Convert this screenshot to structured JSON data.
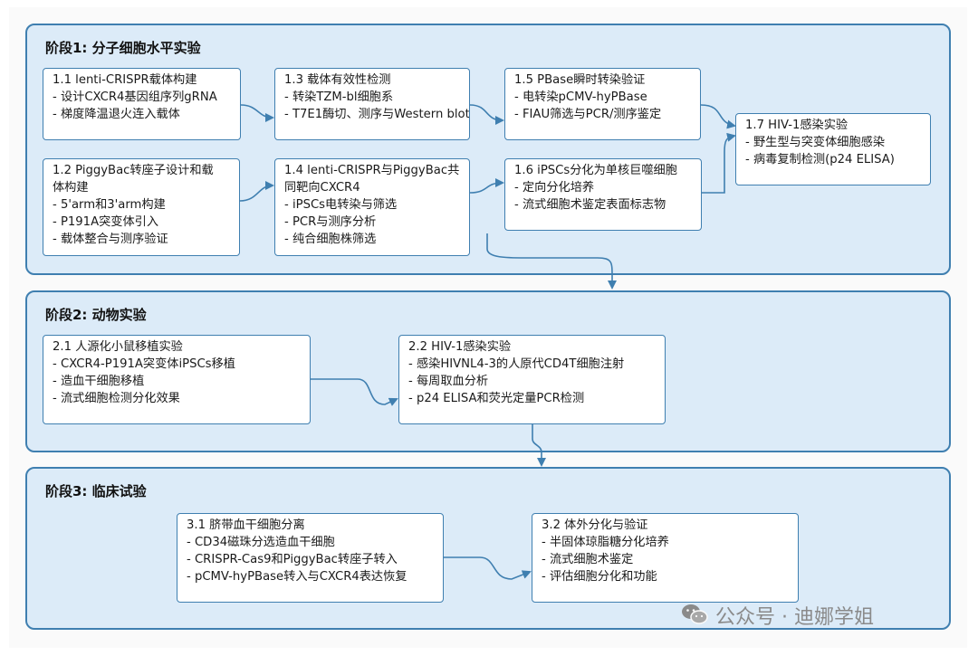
{
  "stages": [
    {
      "title": "阶段1: 分子细胞水平实验",
      "boxes": [
        {
          "title": "1.1 lenti-CRISPR载体构建",
          "items": [
            "- 设计CXCR4基因组序列gRNA",
            "- 梯度降温退火连入载体"
          ]
        },
        {
          "title": "1.2 PiggyBac转座子设计和载体构建",
          "items": [
            "- 5'arm和3'arm构建",
            "- P191A突变体引入",
            "- 载体整合与测序验证"
          ]
        },
        {
          "title": "1.3 载体有效性检测",
          "items": [
            "- 转染TZM-bl细胞系",
            "- T7E1酶切、测序与Western blot"
          ]
        },
        {
          "title": "1.4 lenti-CRISPR与PiggyBac共同靶向CXCR4",
          "items": [
            "- iPSCs电转染与筛选",
            "- PCR与测序分析",
            "- 纯合细胞株筛选"
          ]
        },
        {
          "title": "1.5 PBase瞬时转染验证",
          "items": [
            "- 电转染pCMV-hyPBase",
            "- FIAU筛选与PCR/测序鉴定"
          ]
        },
        {
          "title": "1.6 iPSCs分化为单核巨噬细胞",
          "items": [
            "- 定向分化培养",
            "- 流式细胞术鉴定表面标志物"
          ]
        },
        {
          "title": "1.7 HIV-1感染实验",
          "items": [
            "- 野生型与突变体细胞感染",
            "- 病毒复制检测(p24 ELISA)"
          ]
        }
      ]
    },
    {
      "title": "阶段2: 动物实验",
      "boxes": [
        {
          "title": "2.1 人源化小鼠移植实验",
          "items": [
            "- CXCR4-P191A突变体iPSCs移植",
            "- 造血干细胞移植",
            "- 流式细胞检测分化效果"
          ]
        },
        {
          "title": "2.2 HIV-1感染实验",
          "items": [
            "- 感染HIVNL4-3的人原代CD4T细胞注射",
            "- 每周取血分析",
            "- p24 ELISA和荧光定量PCR检测"
          ]
        }
      ]
    },
    {
      "title": "阶段3: 临床试验",
      "boxes": [
        {
          "title": "3.1 脐带血干细胞分离",
          "items": [
            "- CD34磁珠分选造血干细胞",
            "- CRISPR-Cas9和PiggyBac转座子转入",
            "- pCMV-hyPBase转入与CXCR4表达恢复"
          ]
        },
        {
          "title": "3.2 体外分化与验证",
          "items": [
            "- 半固体琼脂糖分化培养",
            "- 流式细胞术鉴定",
            "- 评估细胞分化和功能"
          ]
        }
      ]
    }
  ],
  "watermark": "公众号 · 迪娜学姐",
  "colors": {
    "stage_fill": "#dcebf8",
    "stage_border": "#3f7fb0",
    "arrow": "#3f7fb0",
    "box_fill": "#ffffff"
  }
}
